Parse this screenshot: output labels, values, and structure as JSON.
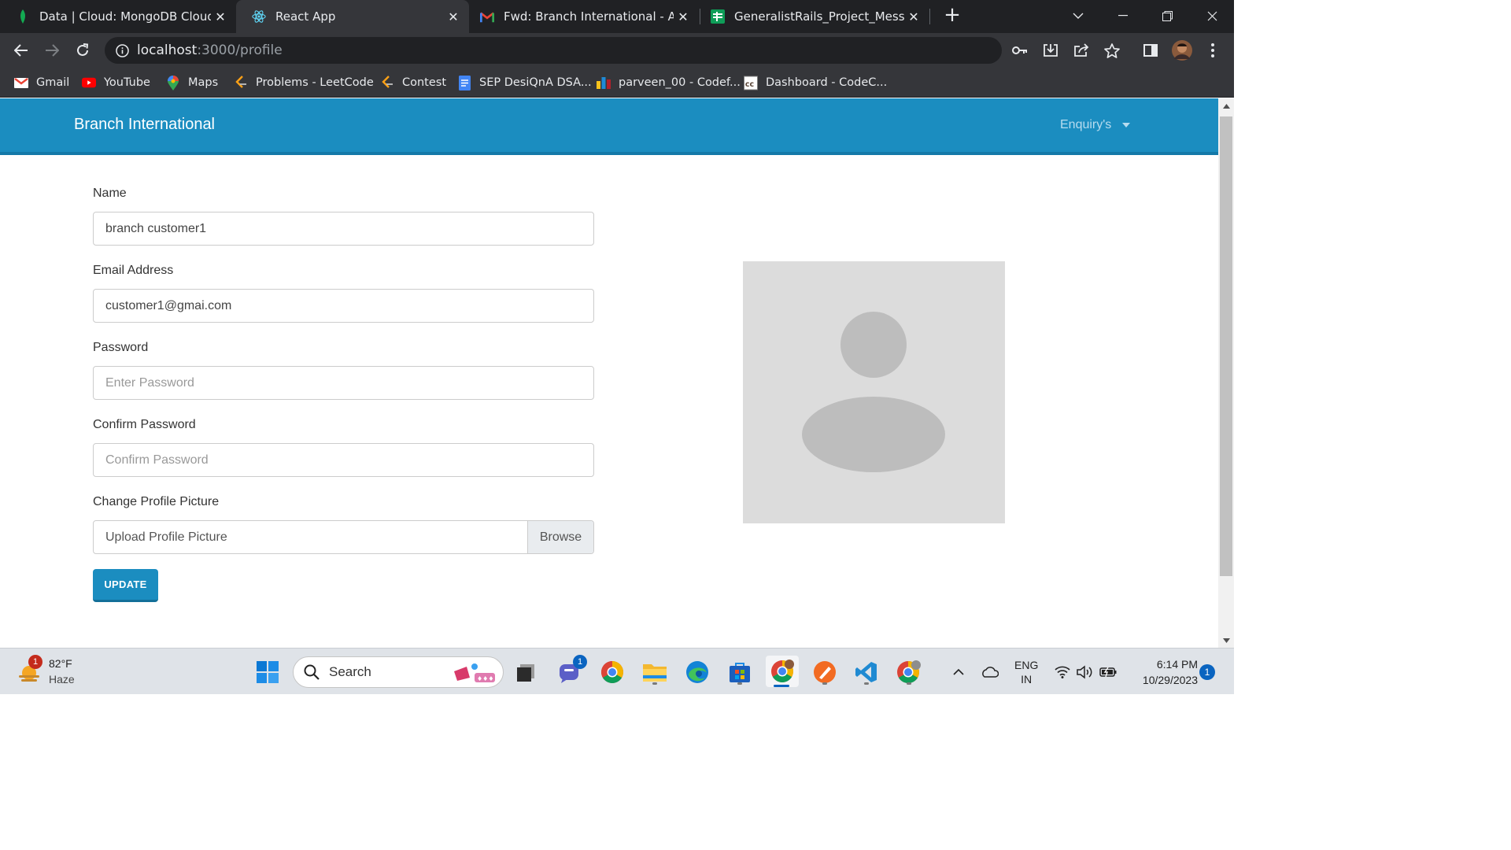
{
  "browser": {
    "tabs": [
      {
        "title": "Data | Cloud: MongoDB Cloud",
        "icon": "mongodb-leaf-icon",
        "active": false
      },
      {
        "title": "React App",
        "icon": "react-icon",
        "active": true
      },
      {
        "title": "Fwd: Branch International - Assig",
        "icon": "gmail-icon",
        "active": false
      },
      {
        "title": "GeneralistRails_Project_Message",
        "icon": "google-sheets-icon",
        "active": false
      }
    ],
    "url_host": "localhost",
    "url_path": ":3000/profile",
    "bookmarks": [
      {
        "label": "Gmail",
        "icon": "gmail-icon"
      },
      {
        "label": "YouTube",
        "icon": "youtube-icon"
      },
      {
        "label": "Maps",
        "icon": "maps-pin-icon"
      },
      {
        "label": "Problems - LeetCode",
        "icon": "leetcode-icon"
      },
      {
        "label": "Contest",
        "icon": "leetcode-icon"
      },
      {
        "label": "SEP DesiQnA DSA...",
        "icon": "google-docs-icon"
      },
      {
        "label": "parveen_00 - Codef...",
        "icon": "codeforces-icon"
      },
      {
        "label": "Dashboard - CodeC...",
        "icon": "codechef-icon"
      }
    ]
  },
  "app": {
    "brand": "Branch International",
    "nav_dropdown": "Enquiry's"
  },
  "form": {
    "name_label": "Name",
    "name_value": "branch customer1",
    "email_label": "Email Address",
    "email_value": "customer1@gmai.com",
    "password_label": "Password",
    "password_placeholder": "Enter Password",
    "confirm_label": "Confirm Password",
    "confirm_placeholder": "Confirm Password",
    "picture_label": "Change Profile Picture",
    "picture_placeholder": "Upload Profile Picture",
    "browse_label": "Browse",
    "update_label": "UPDATE"
  },
  "taskbar": {
    "weather_temp": "82°F",
    "weather_desc": "Haze",
    "weather_badge": "1",
    "search_label": "Search",
    "teams_badge": "1",
    "lang_line1": "ENG",
    "lang_line2": "IN",
    "time": "6:14 PM",
    "date": "10/29/2023",
    "notification_count": "1"
  },
  "colors": {
    "navbar": "#1b8dc0",
    "button": "#1b8dc0",
    "avatar_bg": "#dcdcdc",
    "avatar_fg": "#bdbdbd"
  }
}
